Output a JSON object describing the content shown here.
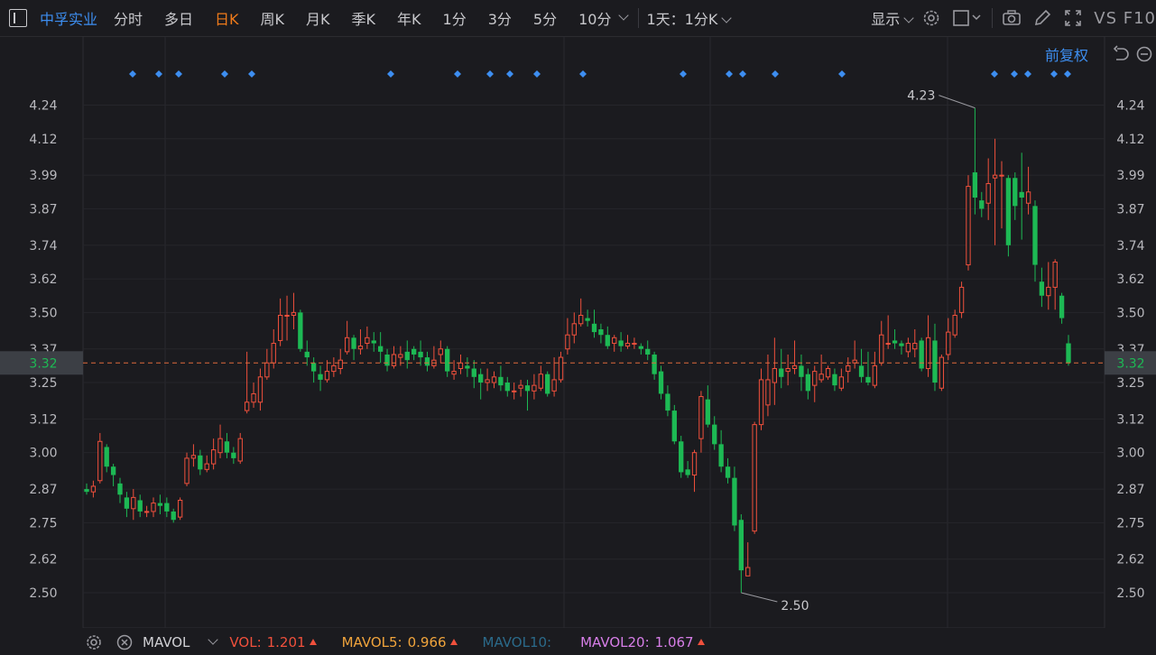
{
  "toolbar": {
    "stock_name": "中孚实业",
    "tabs": [
      "分时",
      "多日",
      "日K",
      "周K",
      "月K",
      "季K",
      "年K",
      "1分",
      "3分",
      "5分",
      "10分"
    ],
    "active_tab": "日K",
    "period_select": "1天：1分K",
    "display_label": "显示",
    "vs_f10": "VS F10"
  },
  "adjust_label": "前复权",
  "footer": {
    "indicator": "MAVOL",
    "vol_label": "VOL:",
    "vol_value": "1.201",
    "mavol5_label": "MAVOL5:",
    "mavol5_value": "0.966",
    "mavol10_label": "MAVOL10:",
    "mavol20_label": "MAVOL20:",
    "mavol20_value": "1.067"
  },
  "colors": {
    "up": "#f0503c",
    "down": "#1db954",
    "accent": "#3d8ef0",
    "active_tab": "#f07b1a",
    "mavol5": "#f0a43c",
    "mavol10": "#2b6a8a",
    "mavol20": "#d77ee8",
    "price_line": "#e06a3c"
  },
  "chart_data": {
    "type": "candlestick",
    "ylim": [
      2.44,
      4.3
    ],
    "y_ticks": [
      "4.24",
      "4.12",
      "3.99",
      "3.87",
      "3.74",
      "3.62",
      "3.50",
      "3.37",
      "3.25",
      "3.12",
      "3.00",
      "2.87",
      "2.75",
      "2.62",
      "2.50"
    ],
    "current_price": "3.32",
    "max_label": "4.23",
    "min_label": "2.50",
    "marker_count": 21,
    "candles": [
      [
        2.87,
        2.86,
        2.89,
        2.85
      ],
      [
        2.86,
        2.88,
        2.9,
        2.84
      ],
      [
        2.9,
        3.04,
        3.07,
        2.89
      ],
      [
        3.02,
        2.95,
        3.03,
        2.93
      ],
      [
        2.95,
        2.92,
        2.96,
        2.88
      ],
      [
        2.89,
        2.85,
        2.91,
        2.82
      ],
      [
        2.84,
        2.8,
        2.86,
        2.77
      ],
      [
        2.8,
        2.84,
        2.87,
        2.76
      ],
      [
        2.83,
        2.79,
        2.85,
        2.77
      ],
      [
        2.79,
        2.79,
        2.81,
        2.77
      ],
      [
        2.79,
        2.82,
        2.84,
        2.77
      ],
      [
        2.82,
        2.81,
        2.85,
        2.78
      ],
      [
        2.82,
        2.79,
        2.84,
        2.77
      ],
      [
        2.79,
        2.76,
        2.8,
        2.75
      ],
      [
        2.77,
        2.83,
        2.84,
        2.76
      ],
      [
        2.89,
        2.98,
        3.0,
        2.88
      ],
      [
        2.98,
        2.99,
        3.03,
        2.95
      ],
      [
        2.99,
        2.94,
        3.01,
        2.92
      ],
      [
        2.94,
        2.96,
        2.99,
        2.93
      ],
      [
        2.96,
        3.01,
        3.05,
        2.94
      ],
      [
        3.0,
        3.05,
        3.1,
        2.98
      ],
      [
        3.04,
        3.0,
        3.07,
        2.98
      ],
      [
        3.0,
        2.98,
        3.02,
        2.96
      ],
      [
        2.97,
        3.05,
        3.07,
        2.96
      ],
      [
        3.15,
        3.18,
        3.36,
        3.14
      ],
      [
        3.18,
        3.21,
        3.25,
        3.16
      ],
      [
        3.18,
        3.27,
        3.3,
        3.15
      ],
      [
        3.27,
        3.32,
        3.37,
        3.26
      ],
      [
        3.32,
        3.39,
        3.44,
        3.3
      ],
      [
        3.4,
        3.49,
        3.55,
        3.38
      ],
      [
        3.49,
        3.49,
        3.56,
        3.4
      ],
      [
        3.49,
        3.5,
        3.57,
        3.44
      ],
      [
        3.5,
        3.37,
        3.51,
        3.36
      ],
      [
        3.36,
        3.34,
        3.4,
        3.31
      ],
      [
        3.32,
        3.29,
        3.34,
        3.25
      ],
      [
        3.28,
        3.26,
        3.31,
        3.22
      ],
      [
        3.26,
        3.29,
        3.33,
        3.25
      ],
      [
        3.29,
        3.31,
        3.34,
        3.27
      ],
      [
        3.3,
        3.33,
        3.37,
        3.28
      ],
      [
        3.36,
        3.41,
        3.47,
        3.35
      ],
      [
        3.41,
        3.37,
        3.42,
        3.33
      ],
      [
        3.37,
        3.38,
        3.44,
        3.35
      ],
      [
        3.39,
        3.41,
        3.45,
        3.37
      ],
      [
        3.4,
        3.39,
        3.43,
        3.36
      ],
      [
        3.38,
        3.36,
        3.43,
        3.32
      ],
      [
        3.35,
        3.31,
        3.37,
        3.29
      ],
      [
        3.31,
        3.35,
        3.38,
        3.3
      ],
      [
        3.34,
        3.35,
        3.38,
        3.31
      ],
      [
        3.36,
        3.33,
        3.4,
        3.3
      ],
      [
        3.37,
        3.35,
        3.38,
        3.33
      ],
      [
        3.36,
        3.34,
        3.4,
        3.31
      ],
      [
        3.34,
        3.31,
        3.36,
        3.29
      ],
      [
        3.31,
        3.33,
        3.38,
        3.3
      ],
      [
        3.35,
        3.37,
        3.4,
        3.32
      ],
      [
        3.37,
        3.29,
        3.38,
        3.27
      ],
      [
        3.28,
        3.29,
        3.33,
        3.26
      ],
      [
        3.3,
        3.32,
        3.35,
        3.28
      ],
      [
        3.31,
        3.3,
        3.34,
        3.27
      ],
      [
        3.3,
        3.27,
        3.33,
        3.23
      ],
      [
        3.28,
        3.25,
        3.3,
        3.19
      ],
      [
        3.25,
        3.26,
        3.3,
        3.22
      ],
      [
        3.25,
        3.27,
        3.29,
        3.23
      ],
      [
        3.27,
        3.24,
        3.31,
        3.22
      ],
      [
        3.25,
        3.22,
        3.27,
        3.2
      ],
      [
        3.22,
        3.22,
        3.25,
        3.19
      ],
      [
        3.23,
        3.24,
        3.26,
        3.2
      ],
      [
        3.24,
        3.22,
        3.26,
        3.15
      ],
      [
        3.22,
        3.24,
        3.28,
        3.19
      ],
      [
        3.23,
        3.28,
        3.31,
        3.22
      ],
      [
        3.28,
        3.21,
        3.29,
        3.2
      ],
      [
        3.22,
        3.26,
        3.34,
        3.2
      ],
      [
        3.26,
        3.34,
        3.36,
        3.25
      ],
      [
        3.37,
        3.42,
        3.48,
        3.35
      ],
      [
        3.42,
        3.46,
        3.5,
        3.39
      ],
      [
        3.46,
        3.49,
        3.55,
        3.45
      ],
      [
        3.48,
        3.47,
        3.51,
        3.45
      ],
      [
        3.46,
        3.43,
        3.51,
        3.41
      ],
      [
        3.44,
        3.42,
        3.46,
        3.39
      ],
      [
        3.42,
        3.38,
        3.45,
        3.37
      ],
      [
        3.39,
        3.41,
        3.42,
        3.36
      ],
      [
        3.4,
        3.38,
        3.43,
        3.36
      ],
      [
        3.38,
        3.39,
        3.42,
        3.37
      ],
      [
        3.39,
        3.39,
        3.41,
        3.37
      ],
      [
        3.38,
        3.37,
        3.39,
        3.35
      ],
      [
        3.37,
        3.35,
        3.4,
        3.33
      ],
      [
        3.35,
        3.28,
        3.36,
        3.26
      ],
      [
        3.29,
        3.21,
        3.31,
        3.19
      ],
      [
        3.21,
        3.15,
        3.24,
        3.13
      ],
      [
        3.15,
        3.04,
        3.17,
        3.03
      ],
      [
        3.04,
        2.93,
        3.06,
        2.91
      ],
      [
        2.94,
        2.92,
        2.97,
        2.91
      ],
      [
        2.92,
        3.0,
        3.01,
        2.86
      ],
      [
        3.05,
        3.2,
        3.22,
        3.0
      ],
      [
        3.19,
        3.1,
        3.24,
        3.09
      ],
      [
        3.1,
        3.03,
        3.13,
        3.01
      ],
      [
        3.03,
        2.95,
        3.08,
        2.93
      ],
      [
        2.95,
        2.91,
        2.98,
        2.89
      ],
      [
        2.91,
        2.74,
        2.95,
        2.72
      ],
      [
        2.76,
        2.58,
        2.78,
        2.5
      ],
      [
        2.56,
        2.59,
        2.68,
        2.56
      ],
      [
        2.72,
        3.1,
        3.11,
        2.71
      ],
      [
        3.1,
        3.26,
        3.3,
        3.08
      ],
      [
        3.17,
        3.26,
        3.35,
        3.13
      ],
      [
        3.25,
        3.3,
        3.41,
        3.17
      ],
      [
        3.3,
        3.27,
        3.37,
        3.23
      ],
      [
        3.29,
        3.3,
        3.35,
        3.24
      ],
      [
        3.3,
        3.31,
        3.4,
        3.28
      ],
      [
        3.31,
        3.27,
        3.35,
        3.22
      ],
      [
        3.28,
        3.22,
        3.3,
        3.19
      ],
      [
        3.24,
        3.29,
        3.31,
        3.18
      ],
      [
        3.26,
        3.28,
        3.35,
        3.25
      ],
      [
        3.27,
        3.3,
        3.31,
        3.26
      ],
      [
        3.28,
        3.24,
        3.3,
        3.22
      ],
      [
        3.23,
        3.27,
        3.3,
        3.22
      ],
      [
        3.29,
        3.31,
        3.34,
        3.25
      ],
      [
        3.32,
        3.33,
        3.4,
        3.3
      ],
      [
        3.31,
        3.27,
        3.37,
        3.25
      ],
      [
        3.27,
        3.25,
        3.36,
        3.24
      ],
      [
        3.24,
        3.31,
        3.36,
        3.23
      ],
      [
        3.32,
        3.42,
        3.47,
        3.31
      ],
      [
        3.39,
        3.39,
        3.49,
        3.37
      ],
      [
        3.4,
        3.39,
        3.44,
        3.37
      ],
      [
        3.39,
        3.38,
        3.4,
        3.35
      ],
      [
        3.36,
        3.39,
        3.41,
        3.34
      ],
      [
        3.37,
        3.39,
        3.44,
        3.34
      ],
      [
        3.4,
        3.3,
        3.41,
        3.29
      ],
      [
        3.3,
        3.41,
        3.49,
        3.27
      ],
      [
        3.4,
        3.25,
        3.46,
        3.22
      ],
      [
        3.23,
        3.34,
        3.35,
        3.22
      ],
      [
        3.35,
        3.43,
        3.48,
        3.33
      ],
      [
        3.42,
        3.49,
        3.51,
        3.41
      ],
      [
        3.5,
        3.59,
        3.61,
        3.48
      ],
      [
        3.67,
        3.95,
        3.99,
        3.65
      ],
      [
        4.0,
        3.91,
        4.23,
        3.85
      ],
      [
        3.9,
        3.87,
        3.93,
        3.84
      ],
      [
        3.89,
        3.96,
        4.05,
        3.83
      ],
      [
        3.98,
        3.99,
        4.12,
        3.74
      ],
      [
        3.99,
        3.99,
        4.04,
        3.8
      ],
      [
        3.98,
        3.74,
        3.99,
        3.7
      ],
      [
        3.98,
        3.88,
        4.0,
        3.83
      ],
      [
        3.93,
        3.91,
        4.07,
        3.76
      ],
      [
        3.89,
        3.93,
        4.02,
        3.85
      ],
      [
        3.88,
        3.67,
        3.9,
        3.61
      ],
      [
        3.61,
        3.56,
        3.66,
        3.52
      ],
      [
        3.56,
        3.59,
        3.68,
        3.51
      ],
      [
        3.59,
        3.68,
        3.69,
        3.51
      ],
      [
        3.56,
        3.48,
        3.57,
        3.46
      ],
      [
        3.39,
        3.32,
        3.42,
        3.31
      ]
    ]
  }
}
